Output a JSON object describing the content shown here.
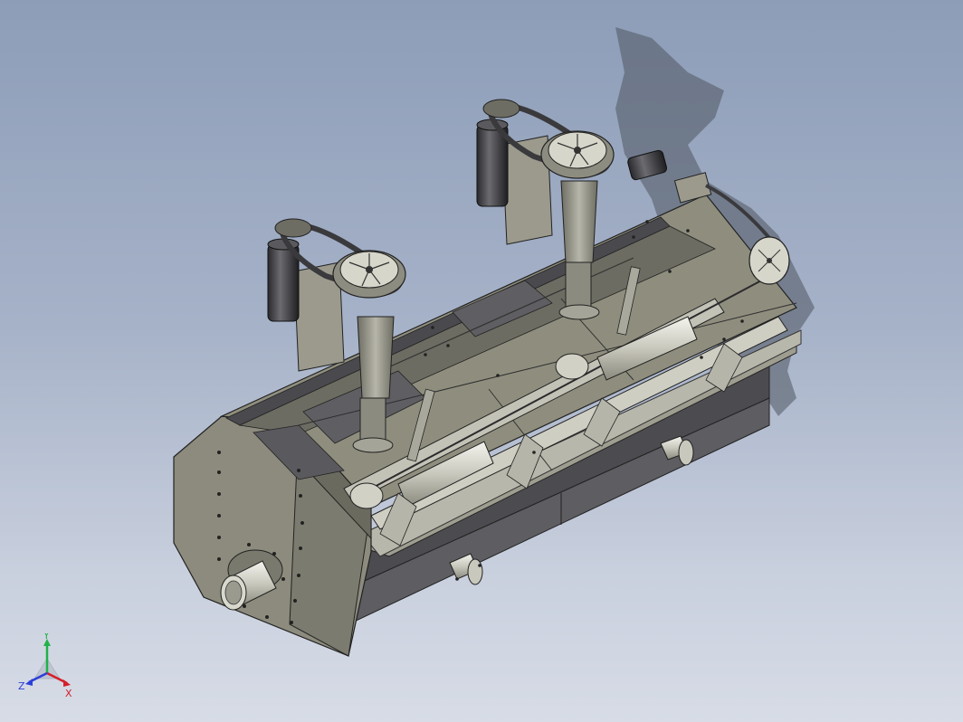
{
  "viewport": {
    "background_top": "#8d9db8",
    "background_bottom": "#d7dce6"
  },
  "model": {
    "description_icon": "flotation-machine-model",
    "body_color": "#8f8e7e",
    "shade_color": "#5c5b52",
    "dark_color": "#3c3c40",
    "light_color": "#c9c8bd"
  },
  "triad": {
    "x_label": "X",
    "y_label": "Y",
    "z_label": "Z",
    "x_color": "#d4202a",
    "y_color": "#1fb24a",
    "z_color": "#2c3fd8"
  }
}
